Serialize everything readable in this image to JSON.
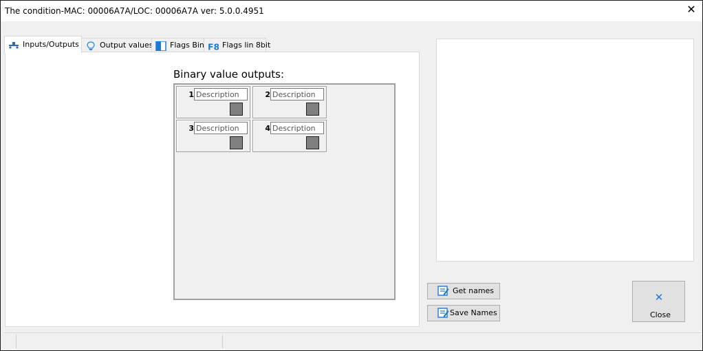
{
  "window": {
    "title": "The condition-MAC: 00006A7A/LOC: 00006A7A ver: 5.0.0.4951",
    "close_glyph": "✕"
  },
  "tabs": [
    {
      "label": "Inputs/Outputs",
      "icon": "io-icon",
      "active": true
    },
    {
      "label": "Output values",
      "icon": "lightbulb-icon",
      "active": false
    },
    {
      "label": "Flags Bin",
      "icon": "flags-bin-icon",
      "active": false
    },
    {
      "label": "Flags lin 8bit",
      "icon": "f8-icon",
      "active": false
    }
  ],
  "section": {
    "title": "Binary value outputs:"
  },
  "outputs": [
    {
      "number": "1",
      "placeholder": "Description",
      "value": ""
    },
    {
      "number": "2",
      "placeholder": "Description",
      "value": ""
    },
    {
      "number": "3",
      "placeholder": "Description",
      "value": ""
    },
    {
      "number": "4",
      "placeholder": "Description",
      "value": ""
    }
  ],
  "buttons": {
    "get_names": "Get names",
    "save_names": "Save Names",
    "close": "Close",
    "close_glyph": "✕"
  },
  "colors": {
    "accent": "#1e78d6",
    "led_off": "#808080"
  }
}
